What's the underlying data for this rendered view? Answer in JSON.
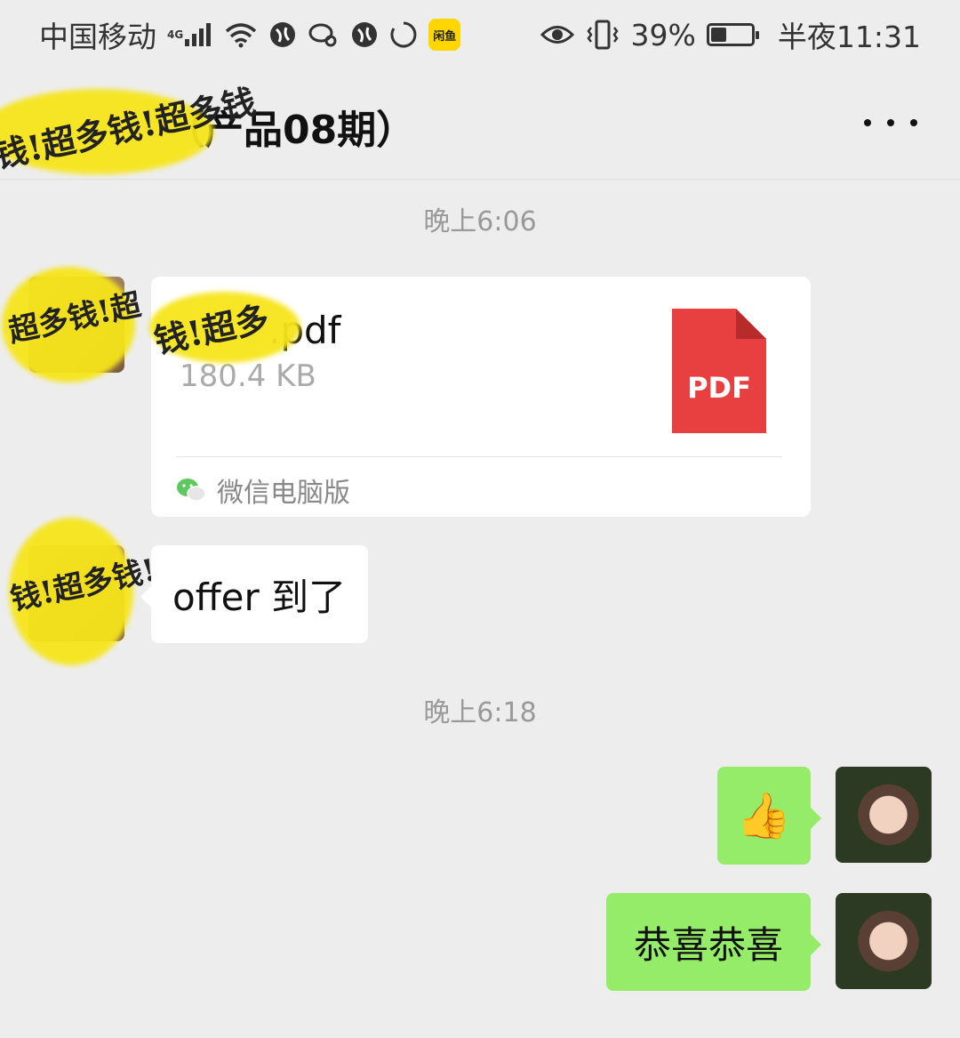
{
  "status_bar": {
    "carrier": "中国移动",
    "network": "4G",
    "app_badge": "闲鱼",
    "battery_text": "39%",
    "battery_level": 0.39,
    "time": "半夜11:31"
  },
  "header": {
    "title": "（产品08期）",
    "redaction_text": "钱!超多钱!超多钱"
  },
  "messages": [
    {
      "type": "timestamp",
      "text": "晚上6:06"
    },
    {
      "type": "file",
      "sender": "other",
      "file_name": ".pdf",
      "file_size": "180.4 KB",
      "file_type_label": "PDF",
      "source": "微信电脑版",
      "redaction_text": "钱!超多",
      "avatar_redaction_text": "超多钱!超"
    },
    {
      "type": "text",
      "sender": "other",
      "text": "offer 到了",
      "avatar_redaction_text": "钱!超多钱!"
    },
    {
      "type": "timestamp",
      "text": "晚上6:18"
    },
    {
      "type": "emoji",
      "sender": "self",
      "emoji": "👍",
      "emoji_name": "thumbs-up"
    },
    {
      "type": "text",
      "sender": "self",
      "text": "恭喜恭喜"
    }
  ],
  "colors": {
    "background": "#ededed",
    "self_bubble": "#95ec69",
    "other_bubble": "#ffffff",
    "pdf_red": "#e84040",
    "redaction_yellow": "#f6e51b"
  }
}
